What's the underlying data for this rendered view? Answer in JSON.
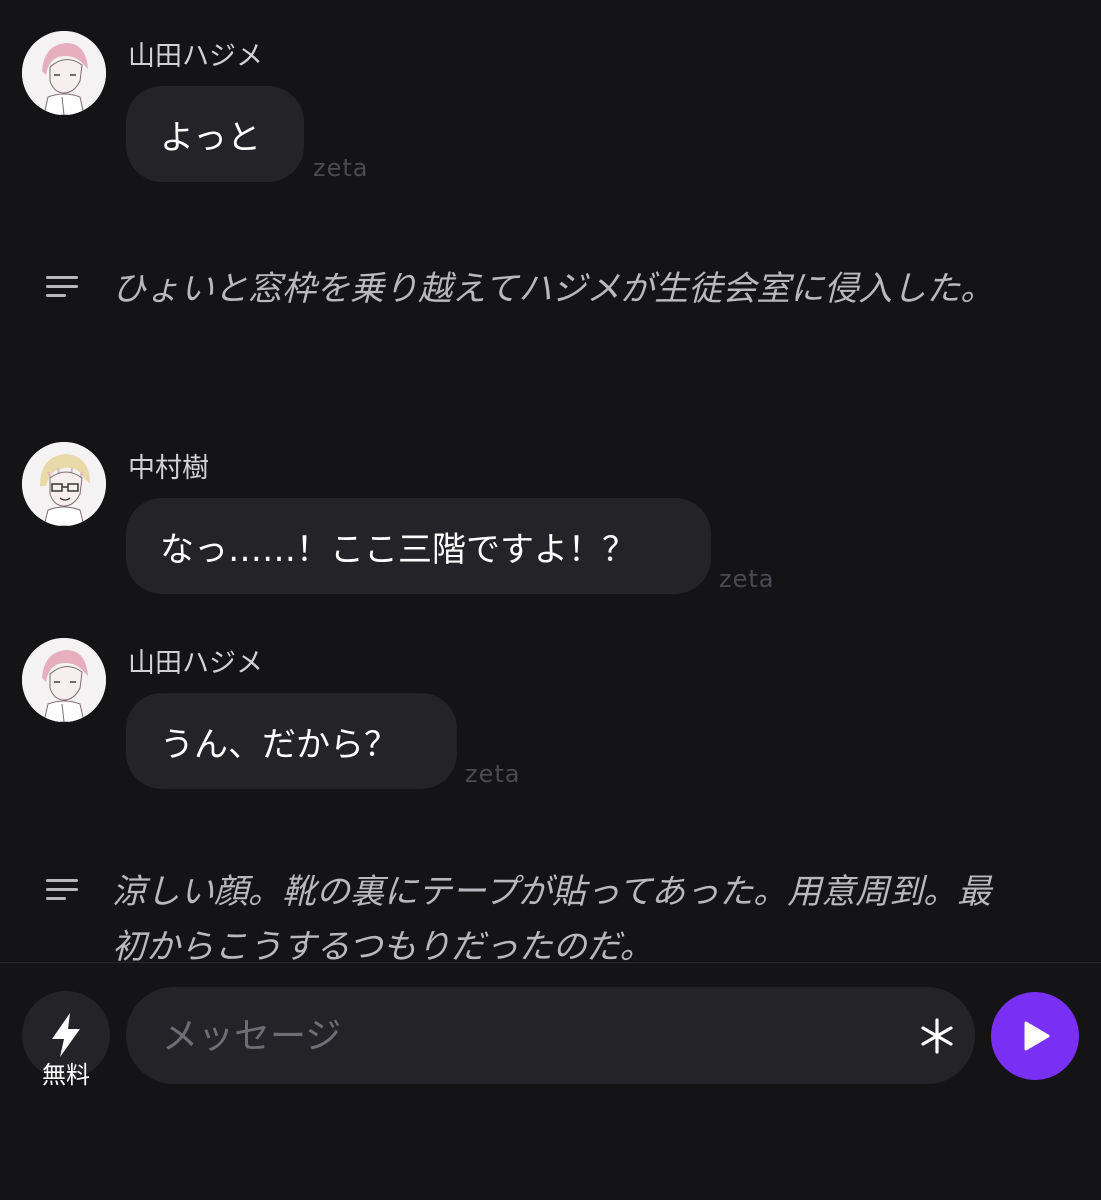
{
  "messages": [
    {
      "sender": "山田ハジメ",
      "text": "よっと",
      "tag": "zeta"
    },
    {
      "narration": "ひょいと窓枠を乗り越えてハジメが生徒会室に侵入した。"
    },
    {
      "sender": "中村樹",
      "text": "なっ……！ここ三階ですよ！？",
      "tag": "zeta"
    },
    {
      "sender": "山田ハジメ",
      "text": "うん、だから？",
      "tag": "zeta"
    },
    {
      "narration": "涼しい顔。靴の裏にテープが貼ってあった。用意周到。最初からこうするつもりだったのだ。"
    }
  ],
  "composer": {
    "free_label": "無料",
    "placeholder": "メッセージ",
    "bolt_icon": "bolt-icon",
    "asterisk_icon": "asterisk-icon",
    "send_icon": "play-icon"
  },
  "colors": {
    "background": "#141416",
    "bubble": "#242428",
    "accent": "#7a2ff5"
  }
}
